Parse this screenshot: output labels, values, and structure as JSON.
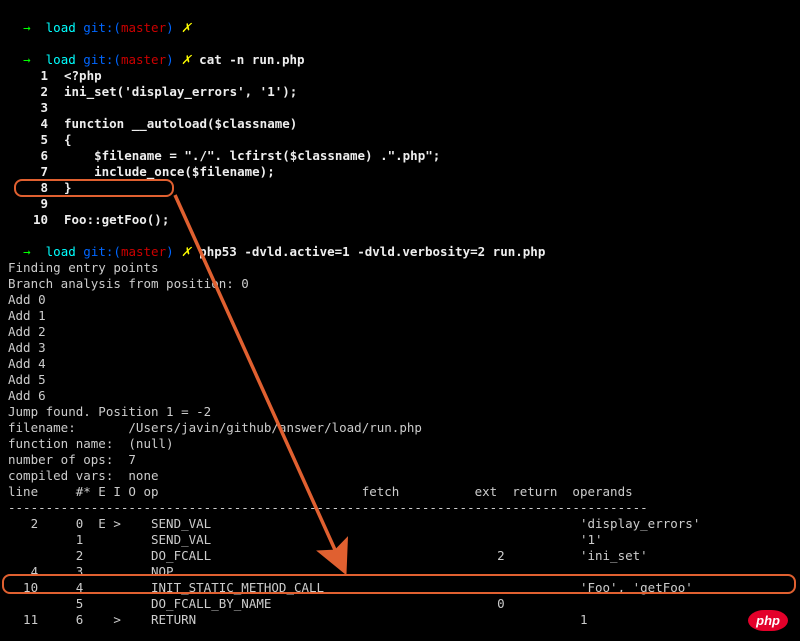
{
  "prompts": [
    {
      "arrow": "→",
      "load": "load",
      "git": "git:(",
      "branch": "master",
      "gitclose": ")",
      "x": "✗",
      "cmd": ""
    },
    {
      "arrow": "→",
      "load": "load",
      "git": "git:(",
      "branch": "master",
      "gitclose": ")",
      "x": "✗",
      "cmd": "cat -n run.php"
    }
  ],
  "source": [
    {
      "n": "1",
      "t": "<?php"
    },
    {
      "n": "2",
      "t": "ini_set('display_errors', '1');"
    },
    {
      "n": "3",
      "t": ""
    },
    {
      "n": "4",
      "t": "function __autoload($classname)"
    },
    {
      "n": "5",
      "t": "{"
    },
    {
      "n": "6",
      "t": "    $filename = \"./\". lcfirst($classname) .\".php\";"
    },
    {
      "n": "7",
      "t": "    include_once($filename);"
    },
    {
      "n": "8",
      "t": "}"
    },
    {
      "n": "9",
      "t": ""
    },
    {
      "n": "10",
      "t": "Foo::getFoo();"
    }
  ],
  "prompt3": {
    "arrow": "→",
    "load": "load",
    "git": "git:(",
    "branch": "master",
    "gitclose": ")",
    "x": "✗",
    "cmd": "php53 -dvld.active=1 -dvld.verbosity=2 run.php"
  },
  "output_lines": [
    "Finding entry points",
    "Branch analysis from position: 0",
    "Add 0",
    "Add 1",
    "Add 2",
    "Add 3",
    "Add 4",
    "Add 5",
    "Add 6",
    "Jump found. Position 1 = -2",
    "filename:       /Users/javin/github/answer/load/run.php",
    "function name:  (null)",
    "number of ops:  7",
    "compiled vars:  none"
  ],
  "header": "line     #* E I O op                           fetch          ext  return  operands",
  "divider": "-------------------------------------------------------------------------------------",
  "opcodes": [
    {
      "ln": "   2",
      "idx": "0",
      "eio": "E >",
      "op": "SEND_VAL",
      "fetch": "",
      "ext": "",
      "ret": "",
      "ops": "'display_errors'"
    },
    {
      "ln": "",
      "idx": "1",
      "eio": "",
      "op": "SEND_VAL",
      "fetch": "",
      "ext": "",
      "ret": "",
      "ops": "'1'"
    },
    {
      "ln": "",
      "idx": "2",
      "eio": "",
      "op": "DO_FCALL",
      "fetch": "",
      "ext": "2",
      "ret": "",
      "ops": "'ini_set'"
    },
    {
      "ln": "   4",
      "idx": "3",
      "eio": "",
      "op": "NOP",
      "fetch": "",
      "ext": "",
      "ret": "",
      "ops": ""
    },
    {
      "ln": "  10",
      "idx": "4",
      "eio": "",
      "op": "INIT_STATIC_METHOD_CALL",
      "fetch": "",
      "ext": "",
      "ret": "",
      "ops": "'Foo', 'getFoo'"
    },
    {
      "ln": "",
      "idx": "5",
      "eio": "",
      "op": "DO_FCALL_BY_NAME",
      "fetch": "",
      "ext": "0",
      "ret": "",
      "ops": ""
    },
    {
      "ln": "  11",
      "idx": "6",
      "eio": "  >",
      "op": "RETURN",
      "fetch": "",
      "ext": "",
      "ret": "",
      "ops": "1"
    }
  ],
  "badge": "php"
}
